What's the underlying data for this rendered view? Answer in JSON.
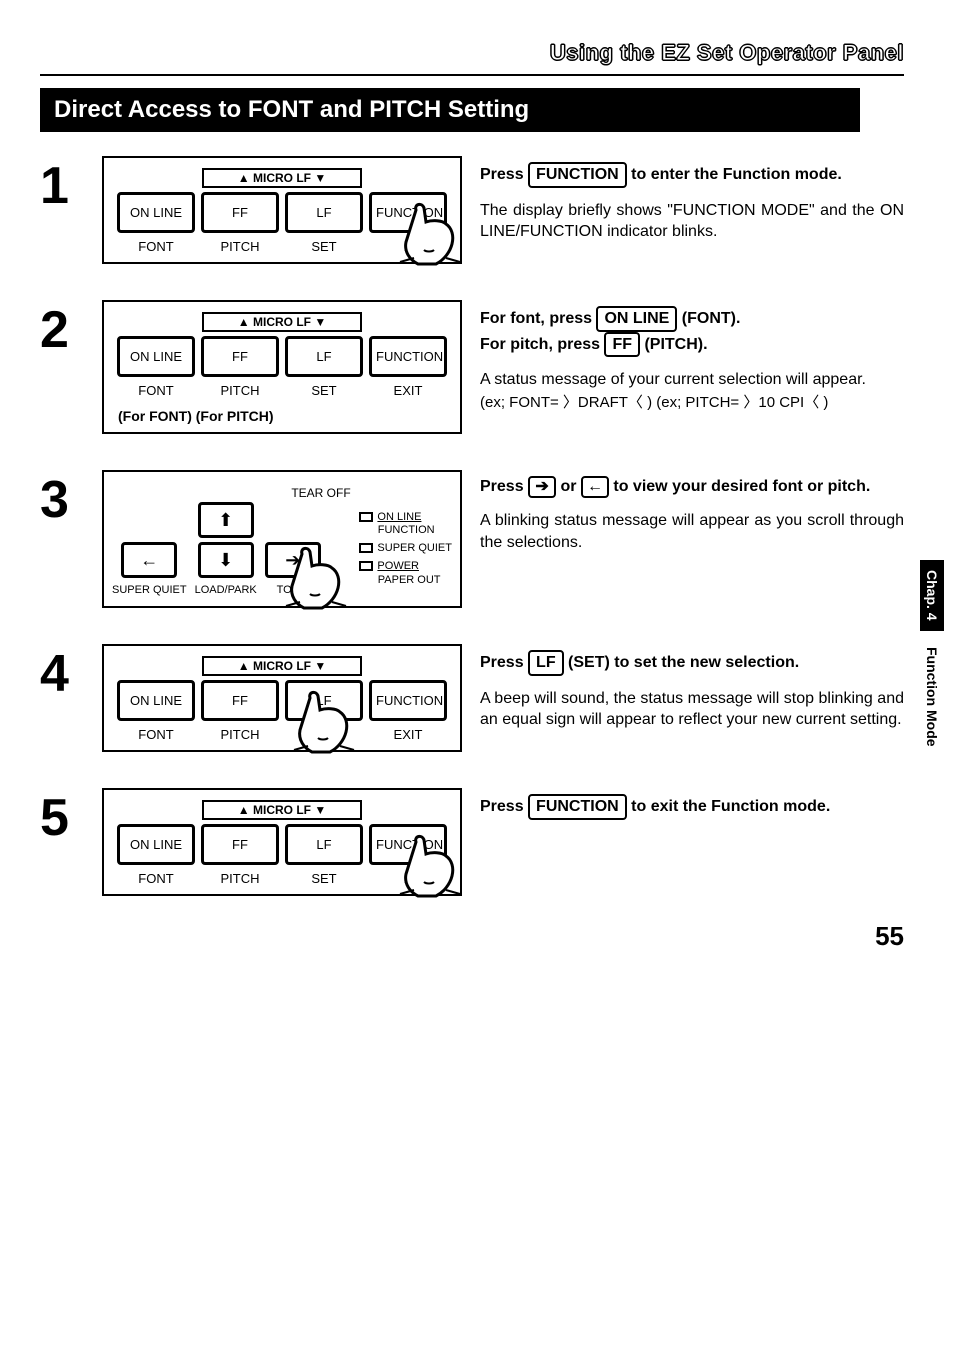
{
  "header": "Using the EZ Set Operator Panel",
  "section_title": "Direct Access to FONT and PITCH Setting",
  "microlf": "▲ MICRO LF ▼",
  "buttons": {
    "online": "ON LINE",
    "ff": "FF",
    "lf": "LF",
    "function": "FUNCTION"
  },
  "labels": {
    "font": "FONT",
    "pitch": "PITCH",
    "set": "SET",
    "exit": "EXIT",
    "e": "E",
    "se": "SE"
  },
  "panel2_caption": "(For FONT)  (For PITCH)",
  "panel3": {
    "tearoff": "TEAR OFF",
    "superquiet": "SUPER QUIET",
    "loadpark": "LOAD/PARK",
    "tof": "TOF S",
    "leds": {
      "online": "ON LINE",
      "function": "FUNCTION",
      "superquiet": "SUPER QUIET",
      "power": "POWER",
      "paperout": "PAPER OUT"
    }
  },
  "steps": [
    {
      "num": "1",
      "lead_pre": "Press ",
      "lead_btn": "FUNCTION",
      "lead_post": " to enter the Function mode.",
      "body": "The display briefly shows \"FUNCTION MODE\" and the ON LINE/FUNCTION indicator blinks."
    },
    {
      "num": "2",
      "lead_l1_pre": "For font, press ",
      "lead_l1_btn": "ON LINE",
      "lead_l1_post": " (FONT).",
      "lead_l2_pre": "For pitch, press ",
      "lead_l2_btn": "FF",
      "lead_l2_post": " (PITCH).",
      "body": "A status message of your current selection will appear.",
      "body2": "(ex; FONT= 〉DRAFT〈 ) (ex; PITCH= 〉10 CPI〈 )"
    },
    {
      "num": "3",
      "lead_pre": "Press ",
      "lead_mid": " or ",
      "lead_post": " to view your desired font or pitch.",
      "body": "A blinking status message will appear as you scroll through the selections."
    },
    {
      "num": "4",
      "lead_pre": "Press ",
      "lead_btn": "LF",
      "lead_post": " (SET) to set the new selection.",
      "body": "A beep will sound, the status message will stop blinking and an equal sign will appear to reflect your new current setting."
    },
    {
      "num": "5",
      "lead_pre": "Press ",
      "lead_btn": "FUNCTION",
      "lead_post": " to exit the Function mode."
    }
  ],
  "sidetab": {
    "chap": "Chap. 4",
    "title": "Function Mode"
  },
  "arrows": {
    "right": "➔",
    "left": "←",
    "up": "⬆",
    "down": "⬇"
  },
  "page_number": "55"
}
